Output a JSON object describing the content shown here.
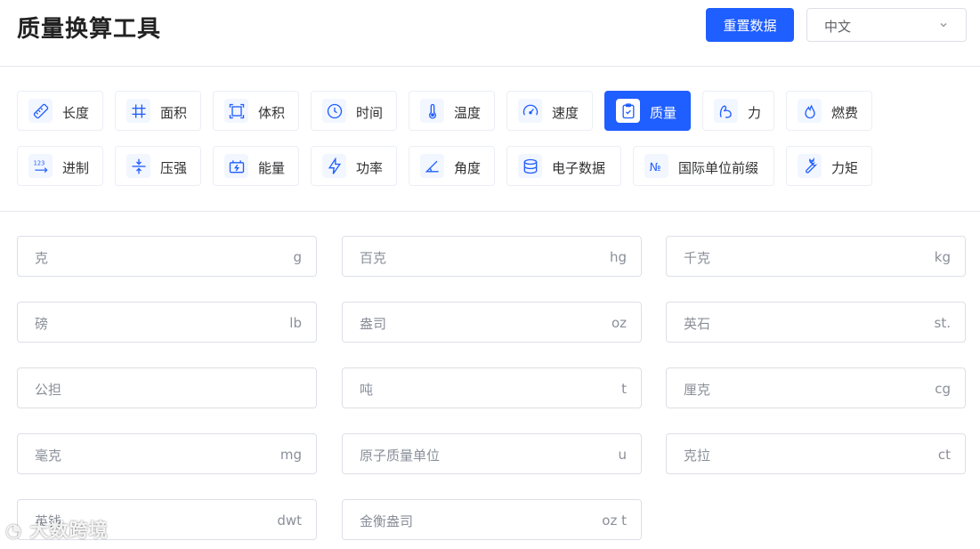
{
  "header": {
    "title": "质量换算工具",
    "reset_label": "重置数据",
    "language_value": "中文"
  },
  "categories": [
    {
      "label": "长度",
      "icon": "ruler-icon"
    },
    {
      "label": "面积",
      "icon": "grid-icon"
    },
    {
      "label": "体积",
      "icon": "box-icon"
    },
    {
      "label": "时间",
      "icon": "clock-icon"
    },
    {
      "label": "温度",
      "icon": "thermometer-icon"
    },
    {
      "label": "速度",
      "icon": "speedometer-icon"
    },
    {
      "label": "质量",
      "icon": "clipboard-check-icon",
      "active": true
    },
    {
      "label": "力",
      "icon": "muscle-icon"
    },
    {
      "label": "燃费",
      "icon": "flame-icon"
    },
    {
      "label": "进制",
      "icon": "number-base-icon"
    },
    {
      "label": "压强",
      "icon": "compress-icon"
    },
    {
      "label": "能量",
      "icon": "battery-icon"
    },
    {
      "label": "功率",
      "icon": "lightning-icon"
    },
    {
      "label": "角度",
      "icon": "angle-icon"
    },
    {
      "label": "电子数据",
      "icon": "database-icon"
    },
    {
      "label": "国际单位前缀",
      "icon": "numero-icon"
    },
    {
      "label": "力矩",
      "icon": "wrench-icon"
    }
  ],
  "fields": [
    {
      "name": "克",
      "unit": "g"
    },
    {
      "name": "百克",
      "unit": "hg"
    },
    {
      "name": "千克",
      "unit": "kg"
    },
    {
      "name": "磅",
      "unit": "lb"
    },
    {
      "name": "盎司",
      "unit": "oz"
    },
    {
      "name": "英石",
      "unit": "st."
    },
    {
      "name": "公担",
      "unit": ""
    },
    {
      "name": "吨",
      "unit": "t"
    },
    {
      "name": "厘克",
      "unit": "cg"
    },
    {
      "name": "毫克",
      "unit": "mg"
    },
    {
      "name": "原子质量单位",
      "unit": "u"
    },
    {
      "name": "克拉",
      "unit": "ct"
    },
    {
      "name": "英钱",
      "unit": "dwt"
    },
    {
      "name": "金衡盎司",
      "unit": "oz t"
    }
  ],
  "watermark": "大数跨境",
  "colors": {
    "accent": "#1f5eff",
    "icon": "#1f5eff",
    "border": "#dcdfe6"
  }
}
